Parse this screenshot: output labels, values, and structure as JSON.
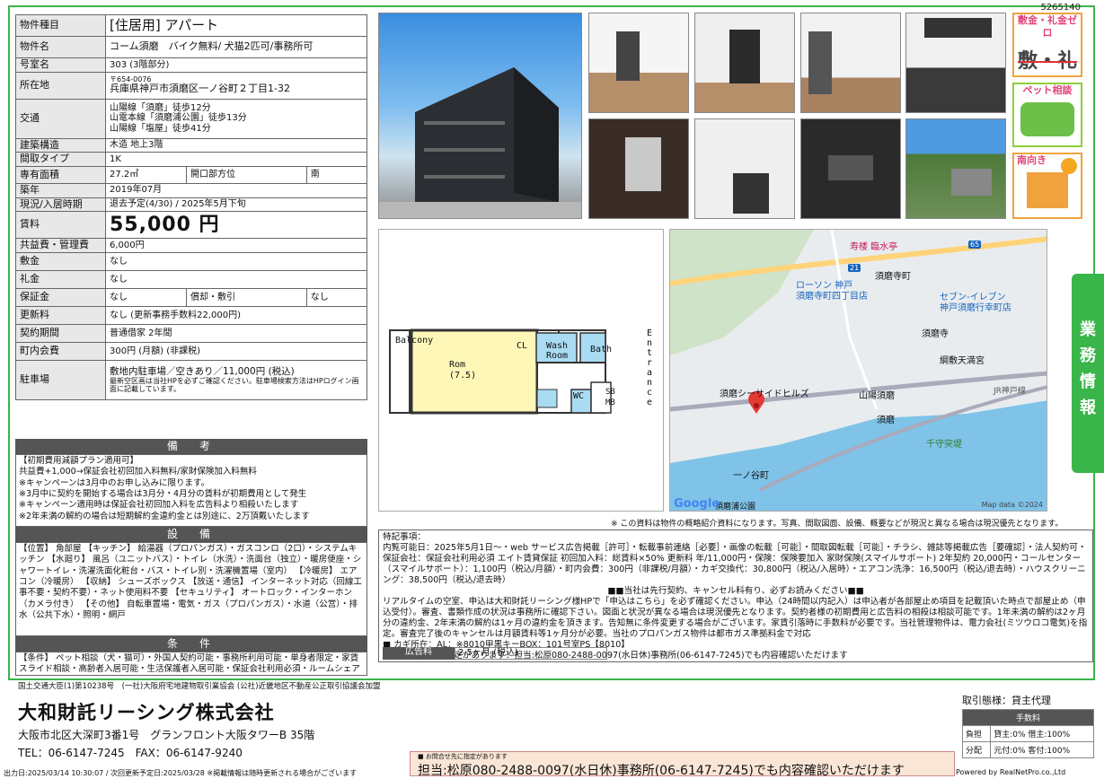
{
  "code": "5265140",
  "spec": {
    "type_label": "物件種目",
    "type_value": "[住居用] アパート",
    "name_label": "物件名",
    "name_value": "コーム須磨　バイク無料/ 犬猫2匹可/事務所可",
    "room_label": "号室名",
    "room_value": "303 (3階部分)",
    "addr_label": "所在地",
    "addr_zip": "〒654-0076",
    "addr_value": "兵庫県神戸市須磨区一ノ谷町２丁目1-32",
    "transit_label": "交通",
    "transit_1": "山陽線「須磨」徒歩12分",
    "transit_2": "山電本線「須磨浦公園」徒歩13分",
    "transit_3": "山陽線「塩屋」徒歩41分",
    "struct_label": "建築構造",
    "struct_value": "木造 地上3階",
    "layout_label": "間取タイプ",
    "layout_value": "1K",
    "area_label": "専有面積",
    "area_value": "27.2㎡",
    "dir_label": "開口部方位",
    "dir_value": "南",
    "built_label": "築年",
    "built_value": "2019年07月",
    "status_label": "現況/入居時期",
    "status_value": "退去予定(4/30) / 2025年5月下旬",
    "rent_label": "賃料",
    "rent_value": "55,000 円",
    "mgmt_label": "共益費・管理費",
    "mgmt_value": "6,000円",
    "shiki_label": "敷金",
    "shiki_value": "なし",
    "rei_label": "礼金",
    "rei_value": "なし",
    "hosho_label": "保証金",
    "hosho_value": "なし",
    "shokyaku_label": "償却・敷引",
    "shokyaku_value": "なし",
    "renew_label": "更新料",
    "renew_value": "なし (更新事務手数料22,000円)",
    "contract_label": "契約期間",
    "contract_value": "普通借家 2年間",
    "town_label": "町内会費",
    "town_value": "300円 (月額) (非課税)",
    "parking_label": "駐車場",
    "parking_value": "敷地内駐車場／空きあり／11,000円 (税込)",
    "parking_note": "最新空区画は当社HPを必ずご確認ください。駐車場検索方法はHPログイン画面に記載しています。"
  },
  "remarks": {
    "title": "備　考",
    "lines": [
      "【初期費用減額プラン適用可】",
      "共益費+1,000→保証会社初回加入料無料/家財保険加入料無料",
      "※キャンペーンは3月中のお申し込みに限ります。",
      "※3月中に契約を開始する場合は3月分・4月分の賃料が初期費用として発生",
      "※キャンペーン適用時は保証会社初回加入料を広告料より相殺いたします",
      "※2年未満の解約の場合は短期解約金違約金とは別途に、2万頂戴いたします"
    ]
  },
  "equip": {
    "title": "設　備",
    "text": "【位置】 角部屋 【キッチン】 給湯器（プロパンガス）・ガスコンロ（2口）・システムキッチン 【水廻り】 風呂（ユニットバス）・トイレ（水洗）・洗面台（独立）・暖房便座・シャワートイレ・洗濯洗面化粧台・バス・トイレ別・洗濯機置場（室内） 【冷暖房】 エアコン（冷暖房） 【収納】 シューズボックス 【放送・通信】 インターネット対応（回線工事不要・契約不要）・ネット使用料不要 【セキュリティ】 オートロック・インターホン（カメラ付き） 【その他】 自転車置場・電気・ガス（プロパンガス）・水道（公営）・排水（公共下水）・照明・網戸"
  },
  "cond": {
    "title": "条　件",
    "text": "【条件】 ペット相談（犬・猫可）・外国人契約可能・事務所利用可能・単身者限定・家賃スライド相談・高齢者入居可能・生活保護者入居可能・保証会社利用必須・ルームシェア可・楽器相談"
  },
  "badges": {
    "zero": "敷金・礼金ゼロ",
    "zero_sub": "敷・礼",
    "pet": "ペット相談",
    "south": "南向き"
  },
  "floor": {
    "balcony": "Balcony",
    "room": "Rom",
    "room_size": "(7.5)",
    "cl": "CL",
    "wash": "Wash",
    "wash2": "Room",
    "bath": "Bath",
    "wc": "WC",
    "sb": "SB",
    "mb": "MB",
    "entrance": "Entrance"
  },
  "map": {
    "l1": "寿楼 臨水亭",
    "l2": "須磨寺町",
    "l3": "ローソン 神戸",
    "l3b": "須磨寺町四丁目店",
    "l4": "セブン-イレブン",
    "l4b": "神戸須磨行幸町店",
    "l5": "須磨寺",
    "l6": "綱敷天満宮",
    "l7": "須磨シーサイドヒルズ",
    "l8": "山陽須磨",
    "l9": "須磨",
    "l10": "千守突堤",
    "l11": "一ノ谷町",
    "l12": "JR神戸線",
    "l13": "須磨浦公園",
    "google": "Google",
    "copy": "Map data ©2024",
    "r21": "21",
    "r65": "65"
  },
  "vtab": [
    "業",
    "務",
    "情",
    "報"
  ],
  "caution": "※ この資料は物件の概略紹介資料になります。写真、間取図面、設備、概要などが現況と異なる場合は現況優先となります。",
  "notes": {
    "title": "特記事項：",
    "lines": [
      "内覧可能日：2025年5月1日〜・web サービス広告掲載［許可］・転載事前連絡［必要］・画像の転載［可能］・間取図転載［可能］・チラシ、雑誌等掲載広告［要確認］・法人契約可・保証会社：保証会社利用必須 エイト賃貸保証 初回加入料：総賃料×50% 更新料 年/11,000円・保険：保険要加入 家財保険(スマイルサポート) 2年契約 20,000円・コールセンター（スマイルサポート）：1,100円（税込/月額）・町内会費：300円（非課税/月額）・カギ交換代：30,800円（税込/入居時）・エアコン洗浄：16,500円（税込/退去時）・ハウスクリーニング：38,500円（税込/退去時）",
      "■■当社は先行契約、キャンセル料有り、必ずお読みください■■",
      "リアルタイムの空室、申込は大和財託リーシング様HPで「申込はこちら」を必ず確認ください。申込（24時間以内記入）は申込者が各部屋止め項目を記載頂いた時点で部屋止め（申込受付）。審査、書類作成の状況は事務所に確認下さい。図面と状況が異なる場合は現況優先となります。契約者様の初期費用と広告料の相殺は相談可能です。1年未満の解約は2ヶ月分の違約金、2年未満の解約は1ヶ月の違約金を頂きます。告知無に条件変更する場合がございます。家賃引落時に手数料が必要です。当社管理物件は、電力会社(ミツウロコ電気)を指定。審査完了後のキャンセルは月額賃料等1ヶ月分が必要。当社のプロパンガス物件は都市ガス準拠料金で対応",
      "■ カギ所在：AL：※8010甲黒キーBOX：101号室PS【8010】",
      "■ お問合せ先に指定があります：担当:松原080-2488-0097(水日休)事務所(06-6147-7245)でも内容確認いただけます"
    ],
    "ad_label": "広告料",
    "ad_value": "2.5ヶ月 (税込)"
  },
  "company": {
    "license": "国土交通大臣(1)第10238号　(一社)大阪府宅地建物取引業協会 (公社)近畿地区不動産公正取引協議会加盟",
    "name": "大和財託リーシング株式会社",
    "address": "大阪市北区大深町3番1号　グランフロント大阪タワーB 35階",
    "tel": "TEL：06-6147-7245　FAX：06-6147-9240"
  },
  "torihiki": {
    "title": "取引態様：貸主代理",
    "fee_title": "手数料",
    "r1l": "負担",
    "r1v": "貸主:0% 借主:100%",
    "r2l": "分配",
    "r2v": "元付:0% 客付:100%"
  },
  "contact": {
    "small": "■ お問合せ先に指定があります",
    "big": "担当:松原080-2488-0097(水日休)事務所(06-6147-7245)でも内容確認いただけます"
  },
  "footer": {
    "left": "出力日:2025/03/14 10:30:07 / 次回更新予定日:2025/03/28 ※掲載情報は随時更新される場合がございます",
    "right": "Powered by RealNetPro.co.,Ltd"
  }
}
